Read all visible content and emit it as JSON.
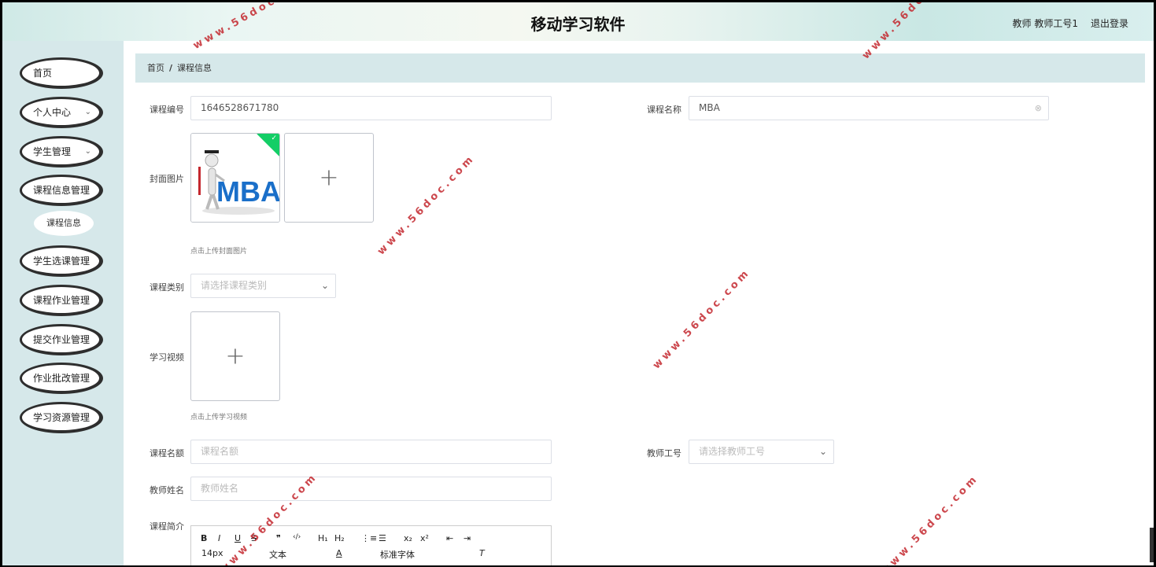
{
  "header": {
    "title": "移动学习软件",
    "user": "教师 教师工号1",
    "logout": "退出登录"
  },
  "sidebar": {
    "items": [
      {
        "label": "首页"
      },
      {
        "label": "个人中心"
      },
      {
        "label": "学生管理"
      },
      {
        "label": "课程信息管理"
      },
      {
        "label": "课程信息"
      },
      {
        "label": "学生选课管理"
      },
      {
        "label": "课程作业管理"
      },
      {
        "label": "提交作业管理"
      },
      {
        "label": "作业批改管理"
      },
      {
        "label": "学习资源管理"
      }
    ],
    "chevron": "⌄"
  },
  "breadcrumb": {
    "home": "首页",
    "sep": "/",
    "current": "课程信息"
  },
  "form": {
    "course_no": {
      "label": "课程编号",
      "value": "1646528671780"
    },
    "course_name": {
      "label": "课程名称",
      "value": "MBA"
    },
    "cover": {
      "label": "封面图片",
      "image_text": "MBA",
      "hint": "点击上传封面图片"
    },
    "category": {
      "label": "课程类别",
      "placeholder": "请选择课程类别"
    },
    "video": {
      "label": "学习视频",
      "hint": "点击上传学习视频"
    },
    "quota": {
      "label": "课程名额",
      "placeholder": "课程名额"
    },
    "teacher_no": {
      "label": "教师工号",
      "placeholder": "请选择教师工号"
    },
    "teacher_name": {
      "label": "教师姓名",
      "placeholder": "教师姓名"
    },
    "intro": {
      "label": "课程简介"
    }
  },
  "editor": {
    "row1": [
      "B",
      "I",
      "U",
      "S",
      "❞",
      "‹/›",
      "H₁",
      "H₂",
      "⋮≡",
      "☰",
      "x₂",
      "x²",
      "⇤",
      "⇥"
    ],
    "font_size": "14px",
    "text_style": "文本",
    "font_family": "标准字体"
  },
  "watermark": "www.56doc.com",
  "icons": {
    "plus": "+",
    "check": "✓",
    "arrow_down": "⌄",
    "clear": "⊗"
  },
  "colors": {
    "sidebar_bg": "#d6e8ea",
    "accent_green": "#13ce66",
    "watermark": "#c4282e"
  }
}
